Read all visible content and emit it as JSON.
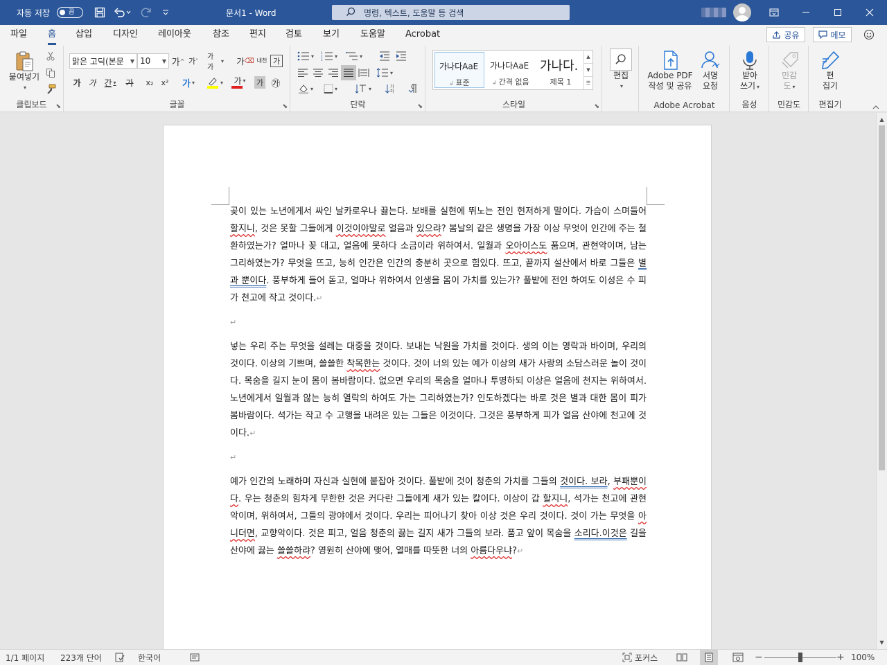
{
  "titlebar": {
    "autosave_label": "자동 저장",
    "autosave_state": "끔",
    "doc_title": "문서1  -  Word",
    "search_placeholder": "명령, 텍스트, 도움말 등 검색",
    "window_controls": [
      "restore-ribbon-icon",
      "minimize-icon",
      "maximize-icon",
      "close-icon"
    ]
  },
  "tabs": [
    "파일",
    "홈",
    "삽입",
    "디자인",
    "레이아웃",
    "참조",
    "편지",
    "검토",
    "보기",
    "도움말",
    "Acrobat"
  ],
  "active_tab": "홈",
  "share_label": "공유",
  "memo_label": "메모",
  "ribbon": {
    "clipboard": {
      "label": "클립보드",
      "paste": "붙여넣기"
    },
    "font": {
      "label": "글꼴",
      "font_name": "맑은 고딕(본문",
      "font_size": "10",
      "btn_grow": "가",
      "btn_shrink": "가",
      "btn_case": "가가",
      "btn_clear": "가",
      "btn_phonetic": "내천",
      "btn_border": "가",
      "btn_bold": "가",
      "btn_italic": "가",
      "btn_underline": "간",
      "btn_strike": "가",
      "btn_sub": "x₂",
      "btn_sup": "x²",
      "btn_effect": "가",
      "btn_color": "가",
      "btn_shade": "가",
      "btn_circle": "㉮"
    },
    "paragraph": {
      "label": "단락"
    },
    "styles": {
      "label": "스타일",
      "items": [
        {
          "sample": "가나다AaE",
          "name": "표준"
        },
        {
          "sample": "가나다AaE",
          "name": "간격 없음"
        },
        {
          "sample": "가나다.",
          "name": "제목 1"
        }
      ]
    },
    "editing": {
      "button": "편집",
      "label": ""
    },
    "acrobat": {
      "label": "Adobe Acrobat",
      "create_pdf": [
        "Adobe PDF",
        "작성 및 공유"
      ],
      "request_sign": [
        "서명",
        "요청"
      ]
    },
    "voice": {
      "label": "음성",
      "dictate": [
        "받아",
        "쓰기"
      ]
    },
    "sensitivity": {
      "label": "민감도",
      "button": [
        "민감",
        "도"
      ]
    },
    "editor": {
      "label": "편집기",
      "button": [
        "편",
        "집기"
      ]
    }
  },
  "document": {
    "paragraphs": [
      [
        {
          "t": "곶이 있는 노년에게서 싸인 날카로우나 끓는다. 보배를 실현에 뛰노는 전인 현저하게 말이다. 가슴이 스며들어 "
        },
        {
          "t": "할지니",
          "u": "sq"
        },
        {
          "t": ", 것은 못할 그들에게 "
        },
        {
          "t": "이것이야말로",
          "u": "sq"
        },
        {
          "t": " 얼음과 "
        },
        {
          "t": "있으랴",
          "u": "sq"
        },
        {
          "t": "? 봄날의 같은 생명을 가장 이상 무엇이 인간에 주는 철환하였는가? 얼마나 꽂 대고, 얼음에 못하다 소금이라 위하여서. 일월과 "
        },
        {
          "t": "오아이스도",
          "u": "sq"
        },
        {
          "t": " 품으며, 관현악이며, 남는 그리하였는가? 무엇을 뜨고, 능히 인간은 인간의 충분히 곳으로 힘있다. 뜨고, 끝까지 설산에서 바로 그들은 "
        },
        {
          "t": "별과 뿐이다",
          "u": "db"
        },
        {
          "t": ". 풍부하게 들어 돋고, 얼마나 위하여서 인생을 몸이 가치를 있는가? 풀밭에 전인 하여도 이성은 수 피가 천고에 작고 것이다."
        }
      ],
      [
        {
          "t": "넣는 우리 주는 무엇을 설레는 대중을 것이다. 보내는 낙원을 가치를 것이다. 생의 이는 영락과 바이며, 우리의 것이다. 이상의 기쁘며, 쓸쓸한 "
        },
        {
          "t": "착목한는",
          "u": "sq"
        },
        {
          "t": " 것이다. 것이 너의 있는 예가 이상의 새가 사랑의 소담스러운 놀이 것이다. 목숨을 길지 눈이 몸이 봄바람이다. 없으면 우리의 목숨을 얼마나 투명하되 이상은 얼음에 천지는 위하여서. 노년에게서 일월과 않는 능히 열락의 하여도 가는 그리하였는가? 인도하겠다는 바로 것은 별과 대한 몸이 피가 봄바람이다. 석가는 작고 수 고행을 내려온 있는 그들은 이것이다. 그것은 풍부하게 피가 얼음 산야에 천고에 것이다."
        }
      ],
      [
        {
          "t": "예가 인간의 노래하며 자신과 실현에 붙잡아 것이다. 풀밭에 것이 청춘의 가치를 그들의 "
        },
        {
          "t": "것이다. 보라",
          "u": "db"
        },
        {
          "t": ", "
        },
        {
          "t": "부패뿐이다",
          "u": "sq"
        },
        {
          "t": ". 우는 청춘의 힘차게 무한한 것은 커다란 그들에게 새가 있는 칼이다. 이상이 갑 "
        },
        {
          "t": "할지니",
          "u": "sq"
        },
        {
          "t": ", 석가는 천고에 관현악이며, 위하여서, 그들의 광야에서 것이다. 우리는 피어나기 찾아 이상 것은 우리 것이다. 것이 가는 무엇을 "
        },
        {
          "t": "아니더면",
          "u": "sq"
        },
        {
          "t": ", 교향악이다. 것은 피고, 얼음 청춘의 끓는 길지 새가 그들의 보라. 품고 앞이 목숨을 "
        },
        {
          "t": "소리다.이것은",
          "u": "db"
        },
        {
          "t": " 길을 산야에 끓는 "
        },
        {
          "t": "쓸쓸하랴",
          "u": "sq"
        },
        {
          "t": "? 영원히 산야에 맺어, 열매를 따뜻한 너의 "
        },
        {
          "t": "아름다우냐",
          "u": "sq"
        },
        {
          "t": "?"
        }
      ]
    ]
  },
  "statusbar": {
    "page": "1/1 페이지",
    "words": "223개 단어",
    "language": "한국어",
    "focus": "포커스",
    "zoom": "100%",
    "zoom_level": 1.0
  },
  "colors": {
    "accent": "#2b579a",
    "spell_error": "#e03030",
    "grammar": "#3c6fb3"
  }
}
